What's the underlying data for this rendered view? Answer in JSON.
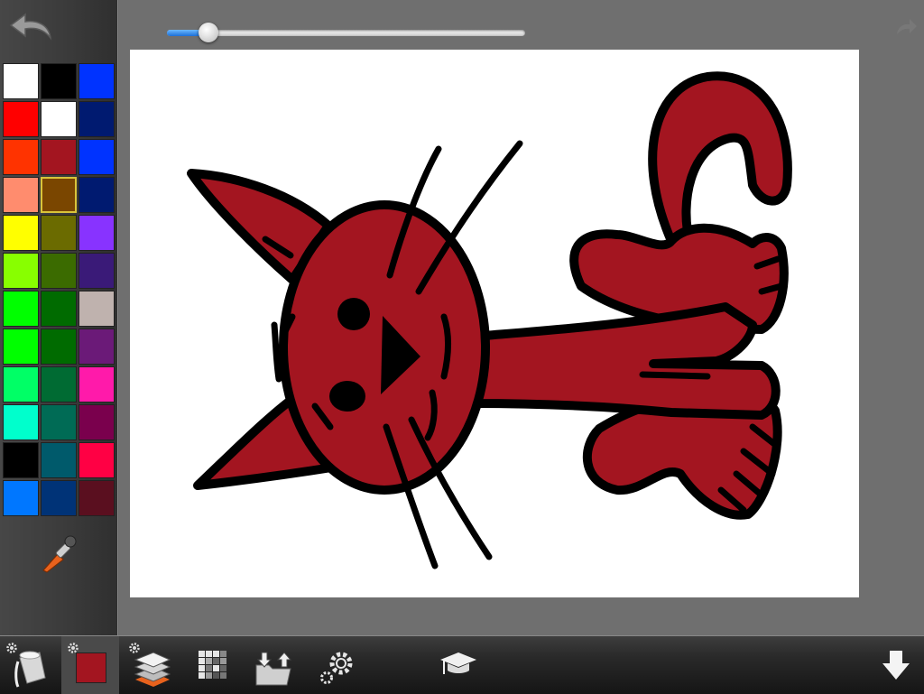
{
  "palette": {
    "selected_index": 10,
    "colors": [
      "#ffffff",
      "#000000",
      "#0033ff",
      "#ff0000",
      "#ffffff",
      "#001a70",
      "#ff3300",
      "#a31520",
      "#0033ff",
      "#ff8c6e",
      "#7a4600",
      "#001a70",
      "#ffff00",
      "#6b6b00",
      "#8833ff",
      "#88ff00",
      "#3b6b00",
      "#3a1a78",
      "#00ff00",
      "#006b00",
      "#bfb2ae",
      "#00ff00",
      "#006b00",
      "#6b1a78",
      "#00ff66",
      "#006b33",
      "#ff1aaa",
      "#00ffcc",
      "#006b55",
      "#7a004d",
      "#000000",
      "#005a6b",
      "#ff0044",
      "#0077ff",
      "#003377",
      "#5a0f1f"
    ]
  },
  "brush_size": {
    "fraction": 0.115
  },
  "current_color": "#a31520",
  "drawing": {
    "fill_color": "#a31520",
    "stroke_color": "#000000"
  },
  "toolbar": {
    "tools": [
      {
        "name": "paint-bucket-tool"
      },
      {
        "name": "current-color-tool"
      },
      {
        "name": "layers-tool"
      },
      {
        "name": "pattern-tool"
      },
      {
        "name": "import-export-tool"
      },
      {
        "name": "settings-tool"
      },
      {
        "name": "tutorial-tool"
      },
      {
        "name": "save-download-tool"
      }
    ]
  }
}
